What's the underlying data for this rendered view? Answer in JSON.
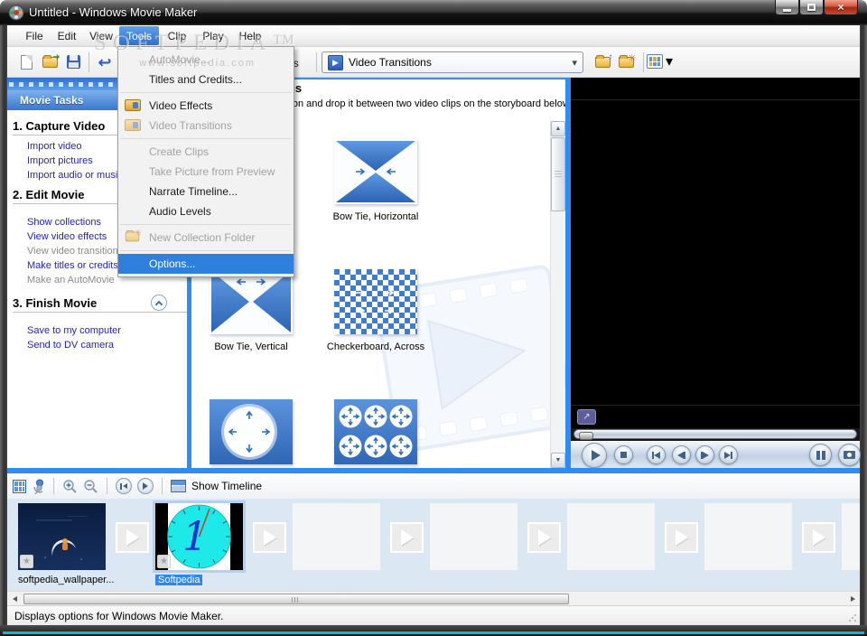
{
  "window": {
    "title": "Untitled - Windows Movie Maker"
  },
  "menu_bar": {
    "items": [
      "File",
      "Edit",
      "View",
      "Tools",
      "Clip",
      "Play",
      "Help"
    ],
    "active_item": "Tools"
  },
  "tools_menu": {
    "automovie": "AutoMovie...",
    "titles_credits": "Titles and Credits...",
    "video_effects": "Video Effects",
    "video_transitions": "Video Transitions",
    "create_clips": "Create Clips",
    "take_picture": "Take Picture from Preview",
    "narrate_timeline": "Narrate Timeline...",
    "audio_levels": "Audio Levels",
    "new_collection_folder": "New Collection Folder",
    "options": "Options..."
  },
  "toolbar": {
    "collections_label": "Collections",
    "transitions_combo_value": "Video Transitions"
  },
  "task_pane": {
    "header": "Movie Tasks",
    "capture": {
      "title": "1. Capture Video",
      "links": [
        "Import video",
        "Import pictures",
        "Import audio or music"
      ]
    },
    "edit": {
      "title": "2. Edit Movie",
      "links": [
        "Show collections",
        "View video effects",
        "View video transitions",
        "Make titles or credits",
        "Make an AutoMovie"
      ]
    },
    "finish": {
      "title": "3. Finish Movie",
      "links": [
        "Save to my computer",
        "Send to DV camera"
      ]
    }
  },
  "content": {
    "title": "Video Transitions",
    "subtitle": "Drag a video transition and drop it between two video clips on the storyboard below.",
    "transitions": [
      {
        "name": "Bow Tie, Horizontal"
      },
      {
        "name": "Bow Tie, Vertical"
      },
      {
        "name": "Checkerboard, Across"
      },
      {
        "name": ""
      },
      {
        "name": ""
      }
    ]
  },
  "storyboard": {
    "show_timeline_label": "Show Timeline",
    "clips": [
      {
        "label": "softpedia_wallpaper...",
        "selected": false
      },
      {
        "label": "Softpedia",
        "selected": true
      }
    ]
  },
  "status_bar": {
    "text": "Displays options for Windows Movie Maker."
  },
  "watermark": {
    "title": "SOFTPEDIA™",
    "url": "www.softpedia.com"
  },
  "colors": {
    "accent_blue": "#2e8cf5",
    "menu_highlight": "#2f80dd",
    "selection_blue": "#2f86f0",
    "transition_blue": "#3f7cc9",
    "close_red": "#c04a30"
  },
  "icons": {
    "close": "×",
    "dropdown_caret": "▾",
    "scroll_up": "▲",
    "scroll_down": "▼",
    "star": "★",
    "undo": "↩",
    "expand": "↗",
    "combo_play": "▶"
  }
}
